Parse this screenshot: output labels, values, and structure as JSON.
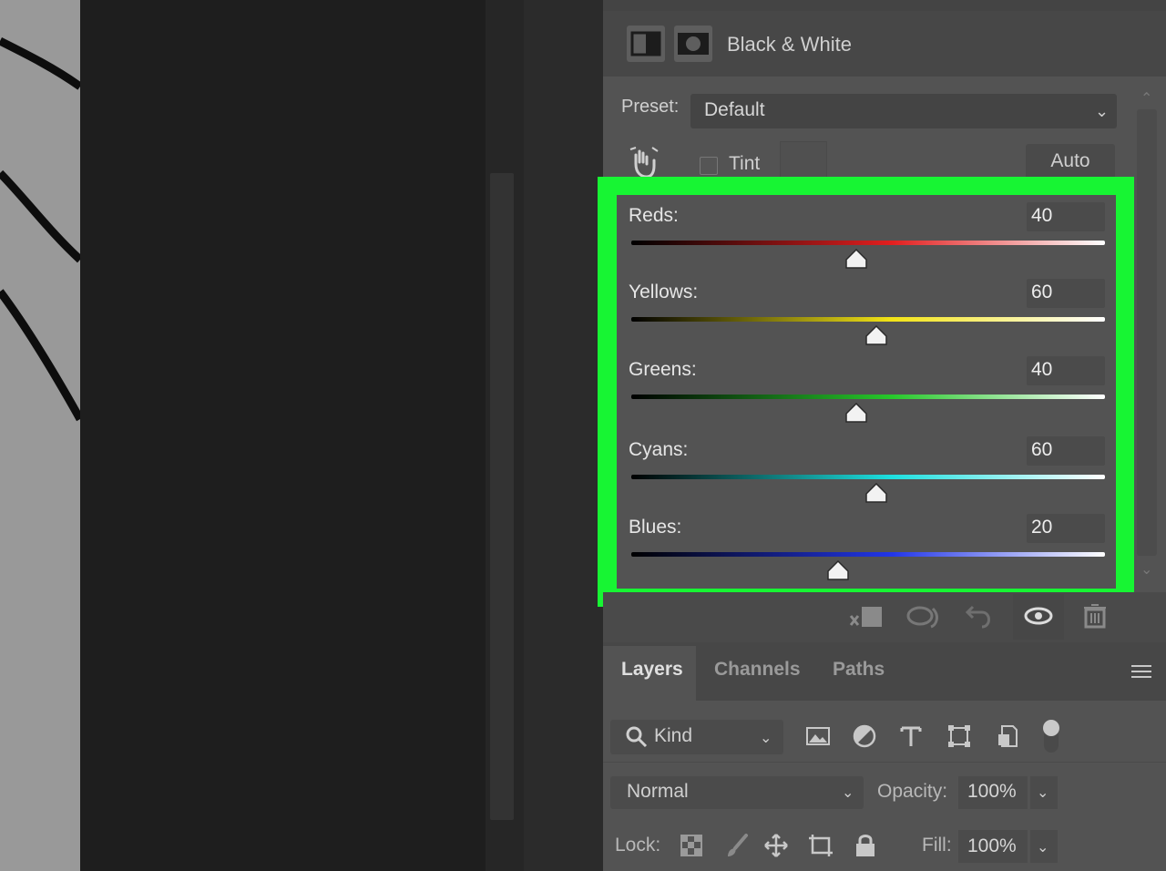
{
  "properties": {
    "title": "Black & White",
    "preset_label": "Preset:",
    "preset_value": "Default",
    "tint_label": "Tint",
    "auto_label": "Auto"
  },
  "sliders": [
    {
      "label": "Reds:",
      "value": "40",
      "fraction": 0.475,
      "color_hex": "#e21f1f"
    },
    {
      "label": "Yellows:",
      "value": "60",
      "fraction": 0.517,
      "color_hex": "#f2e316"
    },
    {
      "label": "Greens:",
      "value": "40",
      "fraction": 0.475,
      "color_hex": "#27c82b"
    },
    {
      "label": "Cyans:",
      "value": "60",
      "fraction": 0.517,
      "color_hex": "#1de0e0"
    },
    {
      "label": "Blues:",
      "value": "20",
      "fraction": 0.437,
      "color_hex": "#2236e8"
    }
  ],
  "highlight_color": "#17f533",
  "layers_panel": {
    "tabs": [
      "Layers",
      "Channels",
      "Paths"
    ],
    "active_tab": "Layers",
    "filter_kind": "Kind",
    "blend_mode": "Normal",
    "opacity_label": "Opacity:",
    "opacity_value": "100%",
    "lock_label": "Lock:",
    "fill_label": "Fill:",
    "fill_value": "100%"
  }
}
